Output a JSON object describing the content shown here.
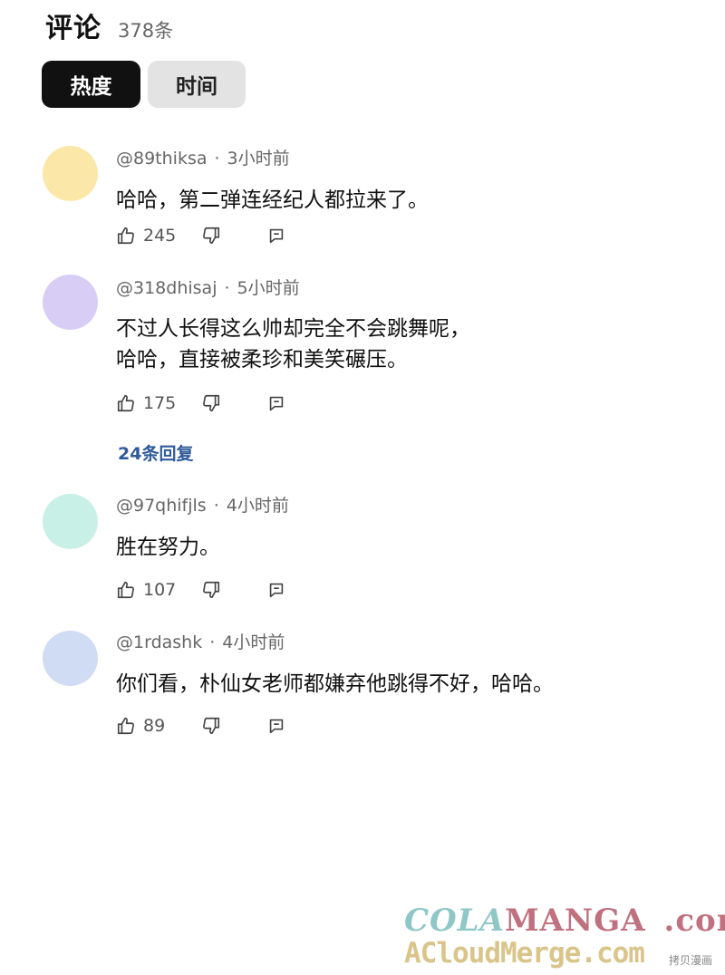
{
  "header": {
    "title": "评论",
    "count": "378条"
  },
  "tabs": [
    {
      "label": "热度",
      "active": true
    },
    {
      "label": "时间",
      "active": false
    }
  ],
  "comments": [
    {
      "user": "@89thiksa",
      "sep": "·",
      "time": "3小时前",
      "lines": [
        "哈哈，第二弹连经纪人都拉来了。"
      ],
      "likes": "245",
      "avatar_color": "#fbe7a8"
    },
    {
      "user": "@318dhisaj",
      "sep": "·",
      "time": "5小时前",
      "lines": [
        "不过人长得这么帅却完全不会跳舞呢，",
        "哈哈，直接被柔珍和美笑碾压。"
      ],
      "likes": "175",
      "avatar_color": "#d8cdf4",
      "replies": "24条回复"
    },
    {
      "user": "@97qhifjls",
      "sep": "·",
      "time": "4小时前",
      "lines": [
        "胜在努力。"
      ],
      "likes": "107",
      "avatar_color": "#c9f0e6"
    },
    {
      "user": "@1rdashk",
      "sep": "·",
      "time": "4小时前",
      "lines": [
        "你们看，朴仙女老师都嫌弃他跳得不好，哈哈。"
      ],
      "likes": "89",
      "avatar_color": "#cfdcf4"
    }
  ],
  "watermark": {
    "cola": "COLA",
    "manga": "MANGA",
    "com": ".com",
    "line2": "ACloudMerge.com",
    "corner": "拷贝漫画"
  },
  "icons": {
    "like": "thumbs-up-icon",
    "dislike": "thumbs-down-icon",
    "reply": "reply-icon"
  }
}
